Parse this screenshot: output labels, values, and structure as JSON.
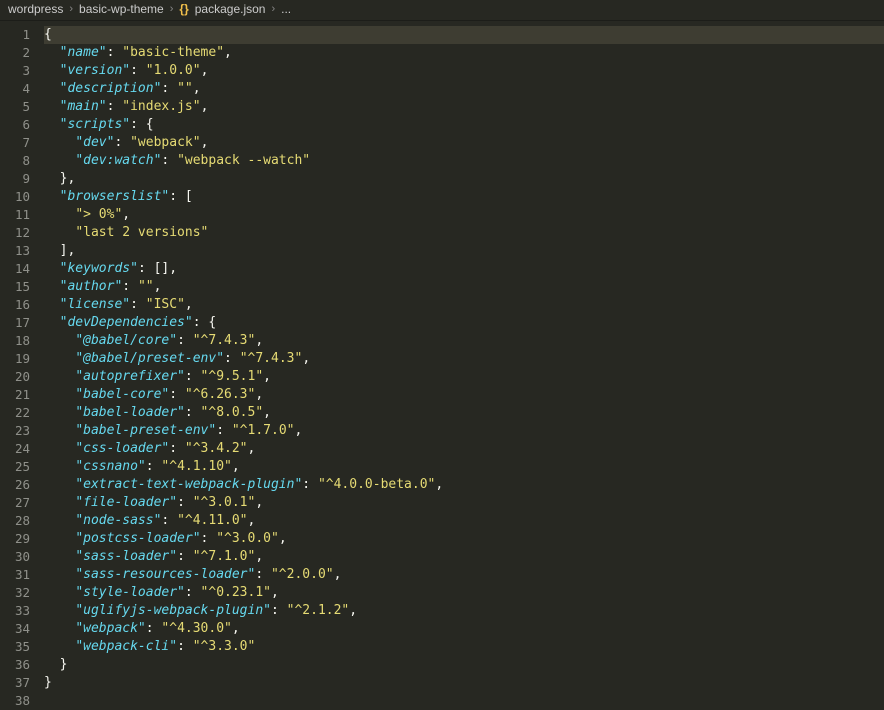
{
  "breadcrumb": {
    "seg1": "wordpress",
    "seg2": "basic-wp-theme",
    "seg3": "package.json",
    "seg4": "...",
    "json_icon": "{}"
  },
  "file": {
    "name": "basic-theme",
    "version": "1.0.0",
    "description": "",
    "main": "index.js",
    "scripts": {
      "dev": "webpack",
      "dev_watch_key": "dev:watch",
      "dev_watch_val": "webpack --watch"
    },
    "browserslist": {
      "entry1": "> 0%",
      "entry2": "last 2 versions"
    },
    "keywords_literal": "[]",
    "author": "",
    "license": "ISC",
    "devDependencies": {
      "babel_core": {
        "k": "@babel/core",
        "v": "^7.4.3"
      },
      "babel_preset_env": {
        "k": "@babel/preset-env",
        "v": "^7.4.3"
      },
      "autoprefixer": {
        "k": "autoprefixer",
        "v": "^9.5.1"
      },
      "babel_core_old": {
        "k": "babel-core",
        "v": "^6.26.3"
      },
      "babel_loader": {
        "k": "babel-loader",
        "v": "^8.0.5"
      },
      "babel_preset_env_old": {
        "k": "babel-preset-env",
        "v": "^1.7.0"
      },
      "css_loader": {
        "k": "css-loader",
        "v": "^3.4.2"
      },
      "cssnano": {
        "k": "cssnano",
        "v": "^4.1.10"
      },
      "extract_text": {
        "k": "extract-text-webpack-plugin",
        "v": "^4.0.0-beta.0"
      },
      "file_loader": {
        "k": "file-loader",
        "v": "^3.0.1"
      },
      "node_sass": {
        "k": "node-sass",
        "v": "^4.11.0"
      },
      "postcss_loader": {
        "k": "postcss-loader",
        "v": "^3.0.0"
      },
      "sass_loader": {
        "k": "sass-loader",
        "v": "^7.1.0"
      },
      "sass_resources_loader": {
        "k": "sass-resources-loader",
        "v": "^2.0.0"
      },
      "style_loader": {
        "k": "style-loader",
        "v": "^0.23.1"
      },
      "uglifyjs": {
        "k": "uglifyjs-webpack-plugin",
        "v": "^2.1.2"
      },
      "webpack": {
        "k": "webpack",
        "v": "^4.30.0"
      },
      "webpack_cli": {
        "k": "webpack-cli",
        "v": "^3.3.0"
      }
    }
  },
  "lines": {
    "count": 38
  }
}
